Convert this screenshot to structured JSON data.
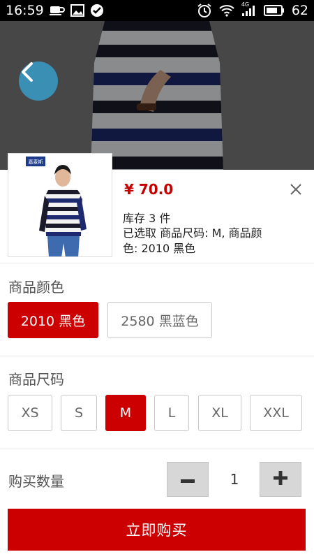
{
  "status_bar": {
    "time": "16:59",
    "battery": "62",
    "network": "4G",
    "left_icons": [
      "cup-icon",
      "image-icon",
      "check-circle-icon"
    ],
    "right_icons": [
      "alarm-icon",
      "wifi-icon",
      "signal-icon",
      "battery-icon"
    ]
  },
  "product": {
    "price": "¥ 70.0",
    "stock": "库存 3 件",
    "selected_text": "已选取 商品尺码: M, 商品颜色: 2010 黑色",
    "thumbnail_brand_text": "嘉麦斯"
  },
  "color_section": {
    "title": "商品颜色",
    "options": [
      {
        "label": "2010 黑色",
        "selected": true
      },
      {
        "label": "2580 黑蓝色",
        "selected": false
      }
    ]
  },
  "size_section": {
    "title": "商品尺码",
    "options": [
      {
        "label": "XS",
        "selected": false
      },
      {
        "label": "S",
        "selected": false
      },
      {
        "label": "M",
        "selected": true
      },
      {
        "label": "L",
        "selected": false
      },
      {
        "label": "XL",
        "selected": false
      },
      {
        "label": "XXL",
        "selected": false
      }
    ]
  },
  "quantity": {
    "label": "购买数量",
    "value": "1",
    "minus_symbol": "−",
    "plus_symbol": "+"
  },
  "buy_button": {
    "label": "立即购买"
  },
  "colors": {
    "accent_red": "#cc0000",
    "price_red": "#c40000",
    "back_button_blue": "#3a8fb5"
  }
}
